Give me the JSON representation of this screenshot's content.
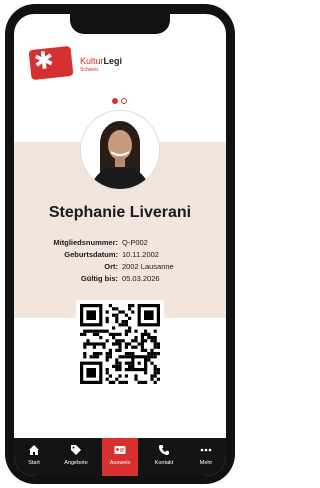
{
  "brand": {
    "name_part1": "Kultur",
    "name_part2": "Legi",
    "subtitle": "Schweiz",
    "color": "#d63030"
  },
  "profile": {
    "name": "Stephanie Liverani"
  },
  "details": [
    {
      "label": "Mitgliedsnummer:",
      "value": "Q-P002"
    },
    {
      "label": "Geburtsdatum:",
      "value": "10.11.2002"
    },
    {
      "label": "Ort:",
      "value": "2002 Lausanne"
    },
    {
      "label": "Gültig bis:",
      "value": "05.03.2026"
    }
  ],
  "carousel": {
    "pages": 2,
    "current": 1
  },
  "tabs": [
    {
      "label": "Start",
      "icon": "home-icon"
    },
    {
      "label": "Angebote",
      "icon": "tag-icon"
    },
    {
      "label": "Ausweis",
      "icon": "id-card-icon",
      "active": true
    },
    {
      "label": "Kontakt",
      "icon": "phone-icon"
    },
    {
      "label": "Mehr",
      "icon": "more-icon"
    }
  ]
}
